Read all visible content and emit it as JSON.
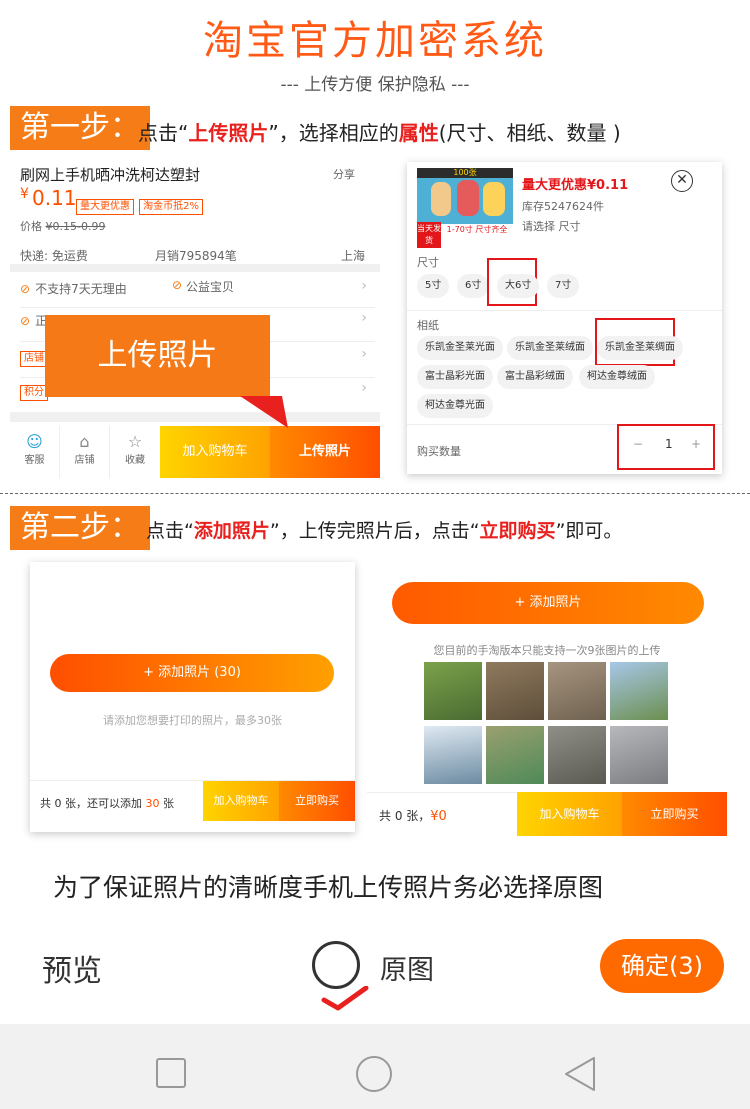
{
  "header": {
    "title": "淘宝官方加密系统",
    "subtitle": "--- 上传方便    保护隐私 ---"
  },
  "step1": {
    "tag": "第一步：",
    "text_a": "点击“",
    "text_b": "上传照片",
    "text_c": "”，选择相应的",
    "text_d": "属性",
    "text_e": "(尺寸、相纸、数量 )"
  },
  "product": {
    "name": "刷网上手机晒冲洗柯达塑封",
    "share": "分享",
    "price_symbol": "¥",
    "price": "0.11",
    "tag1": "量大更优惠",
    "tag2": "淘金币抵2%",
    "orig_price_label": "价格",
    "orig_price": "¥0.15-0.99",
    "shipping": "快递: 免运费",
    "sales": "月销795894笔",
    "location": "上海",
    "guarantee1": "不支持7天无理由",
    "guarantee2": "公益宝贝",
    "row2": "正品",
    "row3": "店铺",
    "row4": "积分",
    "callout": "上传照片",
    "nav_service": "客服",
    "nav_shop": "店铺",
    "nav_fav": "收藏",
    "add_cart": "加入购物车",
    "upload_btn": "上传照片"
  },
  "sku": {
    "thumb_top": "100张",
    "thumb_banner": "1-70寸 尺寸齐全",
    "thumb_left": "当天发货",
    "price_label": "量大更优惠¥0.11",
    "stock": "库存5247624件",
    "select_hint": "请选择 尺寸",
    "size_label": "尺寸",
    "sizes": [
      "5寸",
      "6寸",
      "大6寸",
      "7寸"
    ],
    "paper_label": "相纸",
    "papers": [
      "乐凯金圣莱光面",
      "乐凯金圣莱绒面",
      "乐凯金圣莱绸面",
      "富士晶彩光面",
      "富士晶彩绒面",
      "柯达金尊绒面",
      "柯达金尊光面"
    ],
    "qty_label": "购买数量",
    "qty_minus": "−",
    "qty_value": "1",
    "qty_plus": "+"
  },
  "step2": {
    "tag": "第二步：",
    "text_a": "点击“",
    "text_b": "添加照片",
    "text_c": "”，上传完照片后，点击“",
    "text_d": "立即购买",
    "text_e": "”即可。"
  },
  "upload_left": {
    "add_btn": "+ 添加照片 (30)",
    "hint": "请添加您想要打印的照片，最多30张",
    "count_a": "共 0 张，还可以添加",
    "count_num": "30",
    "count_b": "张",
    "add_cart": "加入购物车",
    "buy_now": "立即购买"
  },
  "upload_right": {
    "add_btn": "+ 添加照片",
    "hint": "您目前的手淘版本只能支持一次9张图片的上传",
    "count": "共 0 张，",
    "amount": "¥0",
    "add_cart": "加入购物车",
    "buy_now": "立即购买"
  },
  "note": "为了保证照片的清晰度手机上传照片务必选择原图",
  "preview_bar": {
    "preview": "预览",
    "original": "原图",
    "confirm": "确定(3)"
  },
  "colors": {
    "accent": "#ff5a16",
    "step_tag": "#f57c17",
    "highlight_red": "#e8211e"
  }
}
